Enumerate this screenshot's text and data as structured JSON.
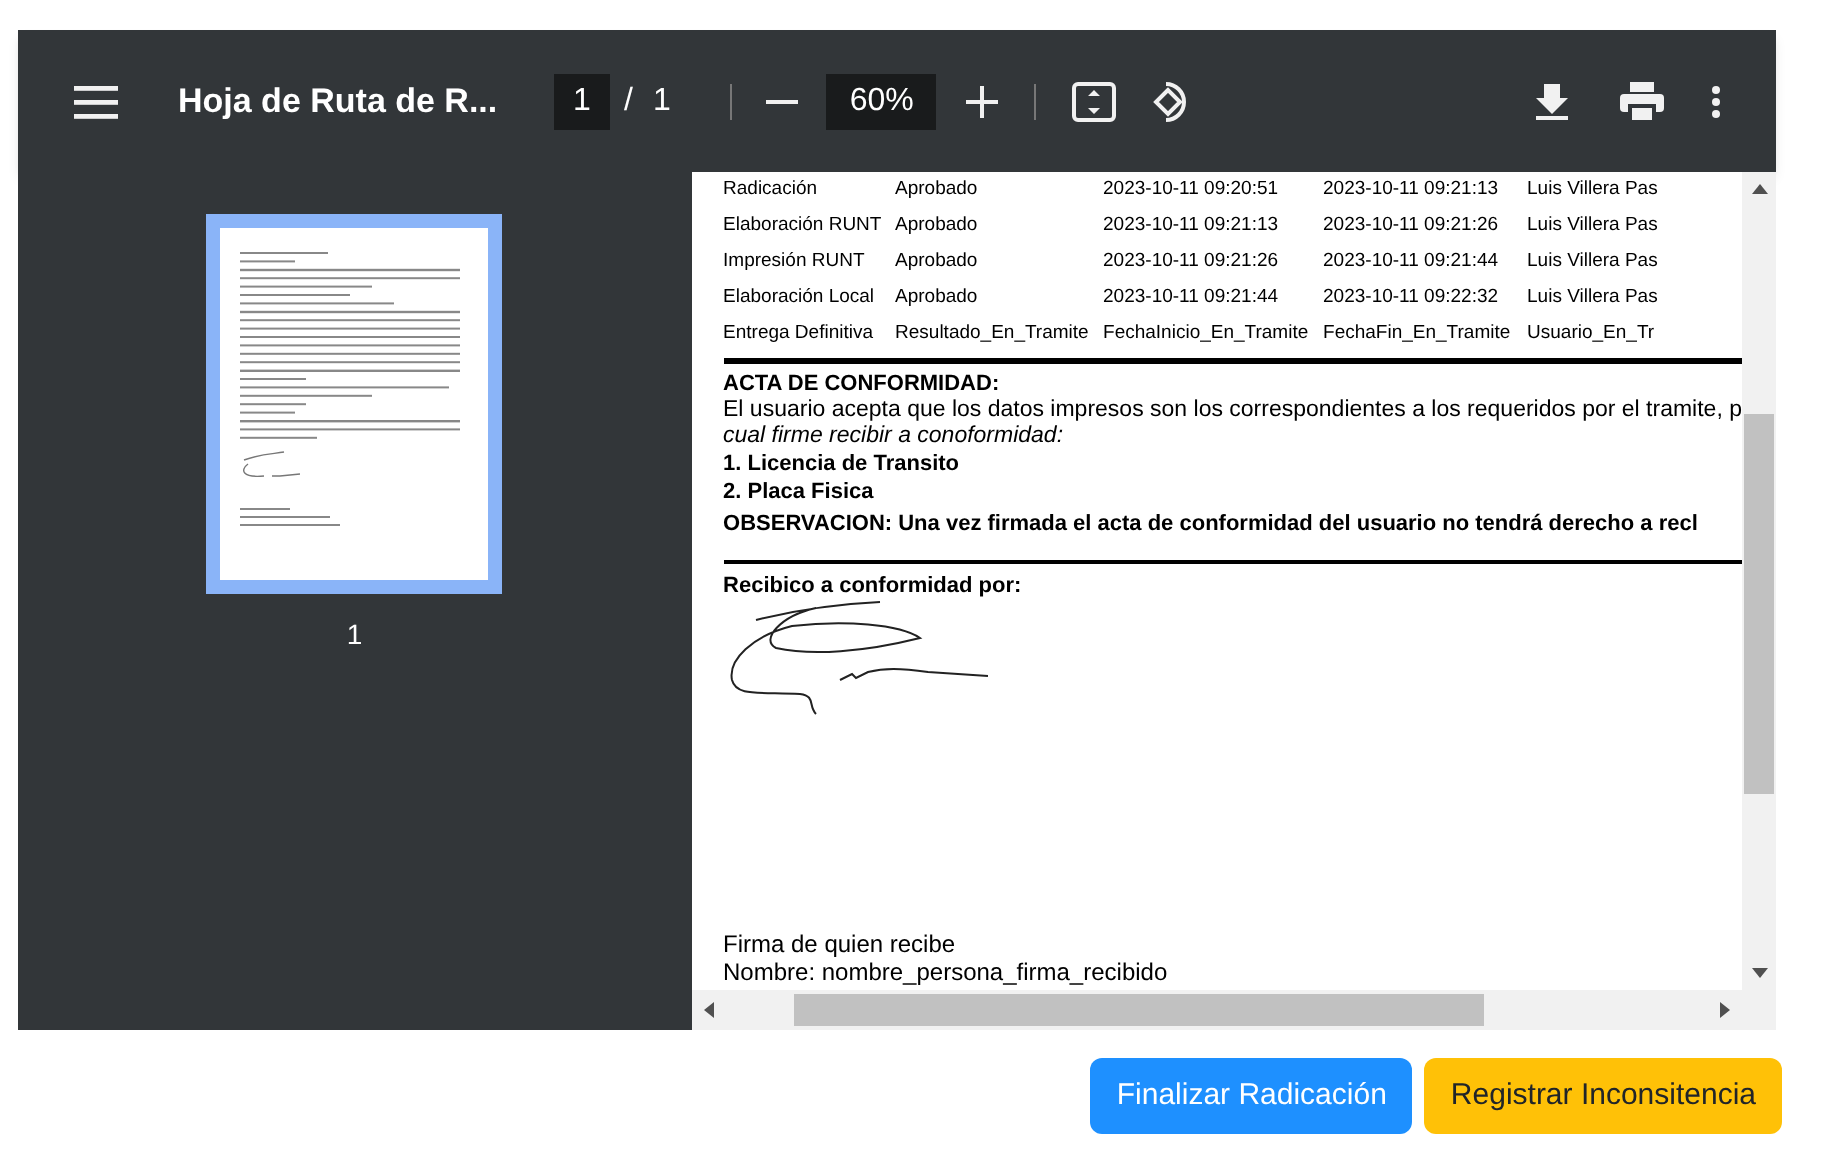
{
  "toolbar": {
    "title": "Hoja de Ruta de R...",
    "page_input": "1",
    "page_separator": "/",
    "page_total": "1",
    "zoom": "60%"
  },
  "thumbnails": [
    {
      "label": "1",
      "selected": true
    }
  ],
  "document": {
    "table_rows": [
      [
        "Radicación",
        "Aprobado",
        "2023-10-11 09:20:51",
        "2023-10-11 09:21:13",
        "Luis Villera Pas"
      ],
      [
        "Elaboración RUNT",
        "Aprobado",
        "2023-10-11 09:21:13",
        "2023-10-11 09:21:26",
        "Luis Villera Pas"
      ],
      [
        "Impresión RUNT",
        "Aprobado",
        "2023-10-11 09:21:26",
        "2023-10-11 09:21:44",
        "Luis Villera Pas"
      ],
      [
        "Elaboración Local",
        "Aprobado",
        "2023-10-11 09:21:44",
        "2023-10-11 09:22:32",
        "Luis Villera Pas"
      ],
      [
        "Entrega Definitiva",
        "Resultado_En_Tramite",
        "FechaInicio_En_Tramite",
        "FechaFin_En_Tramite",
        "Usuario_En_Tr"
      ]
    ],
    "acta_heading": "ACTA DE CONFORMIDAD:",
    "acta_text": "El usuario acepta que los datos impresos son los correspondientes a los requeridos por el tramite, p",
    "acta_text_italic": "cual firme recibir a conoformidad:",
    "items": [
      "1. Licencia de Transito",
      "2. Placa Fisica"
    ],
    "observation": "OBSERVACION: Una vez firmada el acta de conformidad del usuario no tendrá derecho a recl",
    "received_label": "Recibico a conformidad por:",
    "signature_caption": "Firma de quien recibe",
    "name_line": "Nombre: nombre_persona_firma_recibido"
  },
  "buttons": [
    {
      "label": "Finalizar Radicación",
      "kind": "primary"
    },
    {
      "label": "Registrar Inconsitencia",
      "kind": "warning"
    }
  ]
}
